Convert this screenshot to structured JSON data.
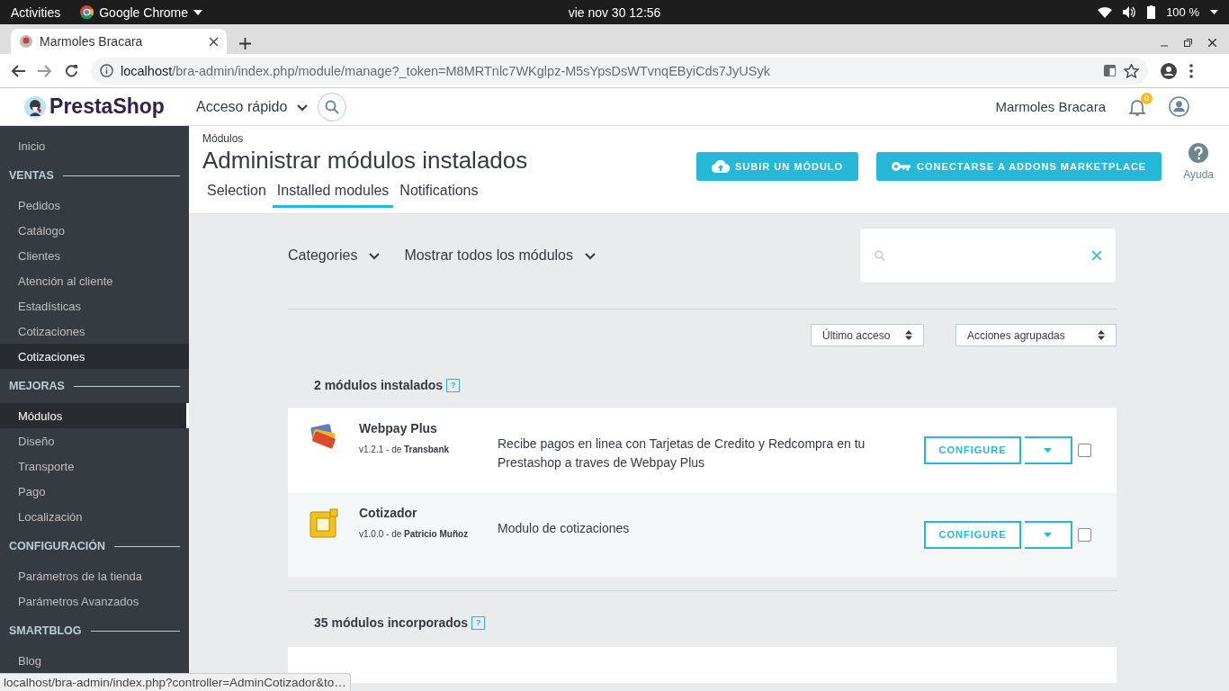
{
  "os_bar": {
    "activities": "Activities",
    "app": "Google Chrome",
    "clock": "vie nov 30  12:56",
    "battery": "100 %"
  },
  "browser": {
    "tab_title": "Marmoles Bracara",
    "url_host": "localhost",
    "url_path": "/bra-admin/index.php/module/manage?_token=M8MRTnlc7WKglpz-M5sYpsDsWTvnqEByiCds7JyUSyk",
    "status_url": "localhost/bra-admin/index.php?controller=AdminCotizador&to…"
  },
  "header": {
    "logo": "PrestaShop",
    "quick_access": "Acceso rápido",
    "shop_name": "Marmoles Bracara",
    "notifications_count": "0"
  },
  "sidebar": {
    "items": [
      {
        "kind": "link",
        "label": "Inicio",
        "selected": false,
        "hovered": false
      },
      {
        "kind": "section",
        "label": "VENTAS"
      },
      {
        "kind": "link",
        "label": "Pedidos",
        "selected": false,
        "hovered": false
      },
      {
        "kind": "link",
        "label": "Catálogo",
        "selected": false,
        "hovered": false
      },
      {
        "kind": "link",
        "label": "Clientes",
        "selected": false,
        "hovered": false
      },
      {
        "kind": "link",
        "label": "Atención al cliente",
        "selected": false,
        "hovered": false
      },
      {
        "kind": "link",
        "label": "Estadísticas",
        "selected": false,
        "hovered": false
      },
      {
        "kind": "link",
        "label": "Cotizaciones",
        "selected": false,
        "hovered": false
      },
      {
        "kind": "link",
        "label": "Cotizaciones",
        "selected": false,
        "hovered": true
      },
      {
        "kind": "section",
        "label": "MEJORAS"
      },
      {
        "kind": "link",
        "label": "Módulos",
        "selected": true,
        "hovered": false
      },
      {
        "kind": "link",
        "label": "Diseño",
        "selected": false,
        "hovered": false
      },
      {
        "kind": "link",
        "label": "Transporte",
        "selected": false,
        "hovered": false
      },
      {
        "kind": "link",
        "label": "Pago",
        "selected": false,
        "hovered": false
      },
      {
        "kind": "link",
        "label": "Localización",
        "selected": false,
        "hovered": false
      },
      {
        "kind": "section",
        "label": "CONFIGURACIÓN"
      },
      {
        "kind": "link",
        "label": "Parámetros de la tienda",
        "selected": false,
        "hovered": false
      },
      {
        "kind": "link",
        "label": "Parámetros Avanzados",
        "selected": false,
        "hovered": false
      },
      {
        "kind": "section",
        "label": "SMARTBLOG"
      },
      {
        "kind": "link",
        "label": "Blog",
        "selected": false,
        "hovered": false
      }
    ]
  },
  "page": {
    "breadcrumb": "Módulos",
    "title": "Administrar módulos instalados",
    "buttons": [
      {
        "kind": "upload",
        "label": "SUBIR UN MÓDULO"
      },
      {
        "kind": "key",
        "label": "CONECTARSE A ADDONS MARKETPLACE"
      }
    ],
    "help": "Ayuda",
    "tabs": [
      {
        "label": "Selection",
        "selected": false
      },
      {
        "label": "Installed modules",
        "selected": true
      },
      {
        "label": "Notifications",
        "selected": false
      }
    ]
  },
  "filters": {
    "categories": "Categories",
    "show": "Mostrar todos los módulos",
    "sort": "Último acceso",
    "bulk": "Acciones agrupadas"
  },
  "installed": {
    "heading": "2 módulos instalados",
    "help": "?",
    "modules": [
      {
        "kind": "cards",
        "name": "Webpay Plus",
        "version": "v1.2.1 - de ",
        "author": "Transbank",
        "description": "Recibe pagos en linea con Tarjetas de Credito y Redcompra en tu Prestashop a traves de Webpay Plus",
        "action": "CONFIGURE",
        "checked": false
      },
      {
        "kind": "ruler",
        "name": "Cotizador",
        "version": "v1.0.0 - de ",
        "author": "Patricio Muñoz",
        "description": "Modulo de cotizaciones",
        "action": "CONFIGURE",
        "checked": false
      }
    ]
  },
  "builtin": {
    "heading": "35 módulos incorporados",
    "help": "?"
  }
}
